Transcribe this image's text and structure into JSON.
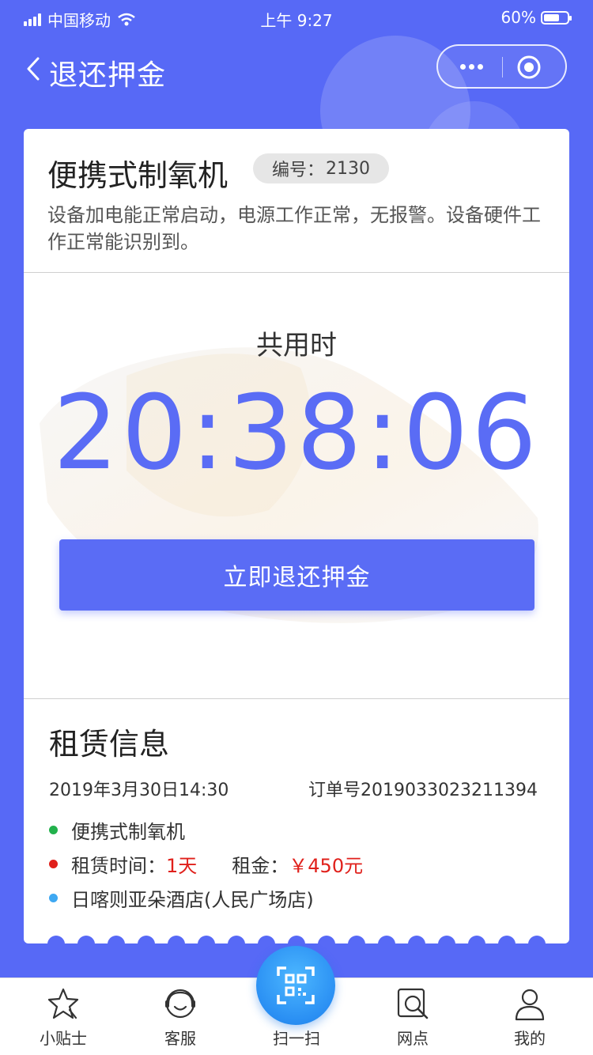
{
  "status_bar": {
    "carrier": "中国移动",
    "time": "上午 9:27",
    "battery": "60%"
  },
  "nav": {
    "title": "退还押金"
  },
  "device": {
    "name": "便携式制氧机",
    "number_label": "编号：",
    "number": "2130",
    "description": "设备加电能正常启动，电源工作正常，无报警。设备硬件工作正常能识别到。"
  },
  "timer": {
    "label": "共用时",
    "value": "20:38:06"
  },
  "refund_button": {
    "label": "立即退还押金"
  },
  "rental": {
    "title": "租赁信息",
    "date": "2019年3月30日14:30",
    "order": "订单号2019033023211394",
    "item_name": "便携式制氧机",
    "duration_label": "租赁时间：",
    "duration_value": "1天",
    "rent_label": "租金：",
    "rent_value": "￥450元",
    "location": "日喀则亚朵酒店(人民广场店)"
  },
  "colors": {
    "primary": "#5a6cf5",
    "price_red": "#e0201b",
    "dot_green": "#22b14c",
    "dot_red": "#e0201b",
    "dot_blue": "#3ea8f2"
  },
  "tabbar": {
    "items": [
      {
        "label": "小贴士",
        "icon": "star-tip-icon"
      },
      {
        "label": "客服",
        "icon": "headset-icon"
      },
      {
        "label": "扫一扫",
        "icon": "qr-scan-icon"
      },
      {
        "label": "网点",
        "icon": "location-search-icon"
      },
      {
        "label": "我的",
        "icon": "user-icon"
      }
    ]
  }
}
